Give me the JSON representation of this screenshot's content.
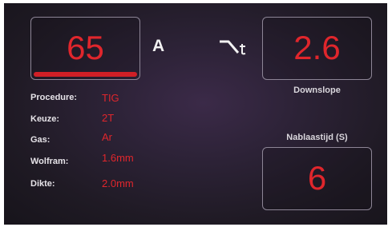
{
  "current": {
    "value": "65",
    "unit": "A"
  },
  "downslope": {
    "value": "2.6",
    "label": "Downslope",
    "icon": "downslope-icon"
  },
  "postflow": {
    "value": "6",
    "label": "Nablaastijd (S)"
  },
  "info": [
    {
      "label": "Procedure:",
      "value": "TIG"
    },
    {
      "label": "Keuze:",
      "value": "2T"
    },
    {
      "label": "Gas:",
      "value": "Ar"
    },
    {
      "label": "Wolfram:",
      "value": "1.6mm"
    },
    {
      "label": "Dikte:",
      "value": "2.0mm"
    }
  ],
  "colors": {
    "value_red": "#e0262c",
    "label_white": "#e6e3e8",
    "box_border": "#8d8596",
    "background": "#2c2236"
  }
}
